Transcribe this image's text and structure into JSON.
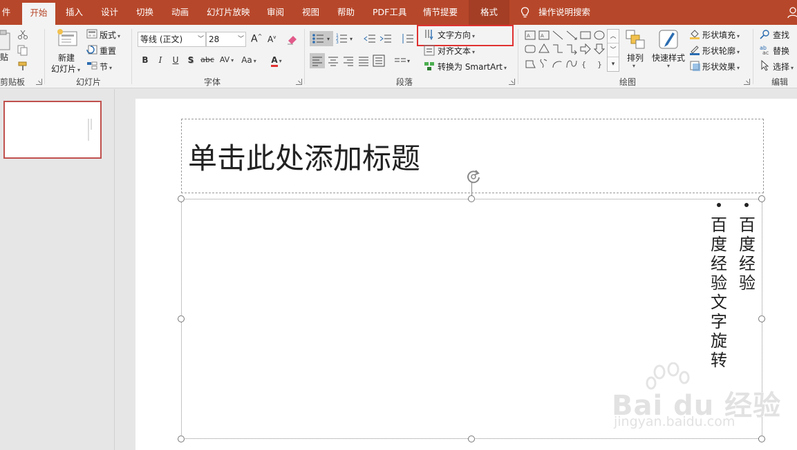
{
  "tabs": [
    {
      "label": "件"
    },
    {
      "label": "开始"
    },
    {
      "label": "插入"
    },
    {
      "label": "设计"
    },
    {
      "label": "切换"
    },
    {
      "label": "动画"
    },
    {
      "label": "幻灯片放映"
    },
    {
      "label": "审阅"
    },
    {
      "label": "视图"
    },
    {
      "label": "帮助"
    },
    {
      "label": "PDF工具"
    },
    {
      "label": "情节提要"
    },
    {
      "label": "格式"
    }
  ],
  "tell_me": "操作说明搜索",
  "ribbon": {
    "clipboard": {
      "label": "剪贴板",
      "paste": "贴"
    },
    "slides": {
      "label": "幻灯片",
      "new_slide_line1": "新建",
      "new_slide_line2": "幻灯片",
      "layout": "版式",
      "reset": "重置",
      "section": "节"
    },
    "font": {
      "label": "字体",
      "font_name": "等线 (正文)",
      "font_size": "28",
      "grow": "A",
      "shrink": "A",
      "bold": "B",
      "italic": "I",
      "underline": "U",
      "shadow": "S",
      "strike": "abc",
      "spacing": "AV",
      "case": "Aa",
      "color": "A"
    },
    "paragraph": {
      "label": "段落",
      "text_direction": "文字方向",
      "align_text": "对齐文本",
      "smartart": "转换为 SmartArt"
    },
    "drawing": {
      "label": "绘图",
      "arrange": "排列",
      "quick_styles": "快速样式",
      "shape_fill": "形状填充",
      "shape_outline": "形状轮廓",
      "shape_effects": "形状效果"
    },
    "editing": {
      "label": "编辑",
      "find": "查找",
      "replace": "替换",
      "select": "选择"
    }
  },
  "slide": {
    "title_placeholder": "单击此处添加标题",
    "column1": [
      "百",
      "度",
      "经",
      "验",
      "文",
      "字",
      "旋",
      "转"
    ],
    "column2": [
      "百",
      "度",
      "经",
      "验"
    ]
  },
  "watermark": {
    "brand": "Bai du 经验",
    "url": "jingyan.baidu.com"
  },
  "colors": {
    "accent": "#b7472a",
    "highlight": "#e03030",
    "thumb_border": "#c0504d"
  }
}
